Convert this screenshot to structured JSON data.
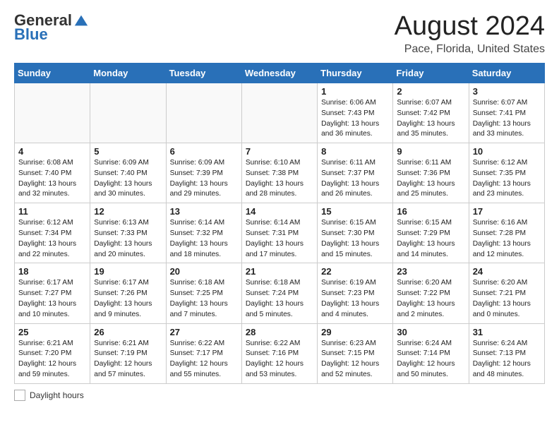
{
  "header": {
    "logo_general": "General",
    "logo_blue": "Blue",
    "month_title": "August 2024",
    "location": "Pace, Florida, United States"
  },
  "weekdays": [
    "Sunday",
    "Monday",
    "Tuesday",
    "Wednesday",
    "Thursday",
    "Friday",
    "Saturday"
  ],
  "weeks": [
    [
      {
        "day": "",
        "info": ""
      },
      {
        "day": "",
        "info": ""
      },
      {
        "day": "",
        "info": ""
      },
      {
        "day": "",
        "info": ""
      },
      {
        "day": "1",
        "info": "Sunrise: 6:06 AM\nSunset: 7:43 PM\nDaylight: 13 hours\nand 36 minutes."
      },
      {
        "day": "2",
        "info": "Sunrise: 6:07 AM\nSunset: 7:42 PM\nDaylight: 13 hours\nand 35 minutes."
      },
      {
        "day": "3",
        "info": "Sunrise: 6:07 AM\nSunset: 7:41 PM\nDaylight: 13 hours\nand 33 minutes."
      }
    ],
    [
      {
        "day": "4",
        "info": "Sunrise: 6:08 AM\nSunset: 7:40 PM\nDaylight: 13 hours\nand 32 minutes."
      },
      {
        "day": "5",
        "info": "Sunrise: 6:09 AM\nSunset: 7:40 PM\nDaylight: 13 hours\nand 30 minutes."
      },
      {
        "day": "6",
        "info": "Sunrise: 6:09 AM\nSunset: 7:39 PM\nDaylight: 13 hours\nand 29 minutes."
      },
      {
        "day": "7",
        "info": "Sunrise: 6:10 AM\nSunset: 7:38 PM\nDaylight: 13 hours\nand 28 minutes."
      },
      {
        "day": "8",
        "info": "Sunrise: 6:11 AM\nSunset: 7:37 PM\nDaylight: 13 hours\nand 26 minutes."
      },
      {
        "day": "9",
        "info": "Sunrise: 6:11 AM\nSunset: 7:36 PM\nDaylight: 13 hours\nand 25 minutes."
      },
      {
        "day": "10",
        "info": "Sunrise: 6:12 AM\nSunset: 7:35 PM\nDaylight: 13 hours\nand 23 minutes."
      }
    ],
    [
      {
        "day": "11",
        "info": "Sunrise: 6:12 AM\nSunset: 7:34 PM\nDaylight: 13 hours\nand 22 minutes."
      },
      {
        "day": "12",
        "info": "Sunrise: 6:13 AM\nSunset: 7:33 PM\nDaylight: 13 hours\nand 20 minutes."
      },
      {
        "day": "13",
        "info": "Sunrise: 6:14 AM\nSunset: 7:32 PM\nDaylight: 13 hours\nand 18 minutes."
      },
      {
        "day": "14",
        "info": "Sunrise: 6:14 AM\nSunset: 7:31 PM\nDaylight: 13 hours\nand 17 minutes."
      },
      {
        "day": "15",
        "info": "Sunrise: 6:15 AM\nSunset: 7:30 PM\nDaylight: 13 hours\nand 15 minutes."
      },
      {
        "day": "16",
        "info": "Sunrise: 6:15 AM\nSunset: 7:29 PM\nDaylight: 13 hours\nand 14 minutes."
      },
      {
        "day": "17",
        "info": "Sunrise: 6:16 AM\nSunset: 7:28 PM\nDaylight: 13 hours\nand 12 minutes."
      }
    ],
    [
      {
        "day": "18",
        "info": "Sunrise: 6:17 AM\nSunset: 7:27 PM\nDaylight: 13 hours\nand 10 minutes."
      },
      {
        "day": "19",
        "info": "Sunrise: 6:17 AM\nSunset: 7:26 PM\nDaylight: 13 hours\nand 9 minutes."
      },
      {
        "day": "20",
        "info": "Sunrise: 6:18 AM\nSunset: 7:25 PM\nDaylight: 13 hours\nand 7 minutes."
      },
      {
        "day": "21",
        "info": "Sunrise: 6:18 AM\nSunset: 7:24 PM\nDaylight: 13 hours\nand 5 minutes."
      },
      {
        "day": "22",
        "info": "Sunrise: 6:19 AM\nSunset: 7:23 PM\nDaylight: 13 hours\nand 4 minutes."
      },
      {
        "day": "23",
        "info": "Sunrise: 6:20 AM\nSunset: 7:22 PM\nDaylight: 13 hours\nand 2 minutes."
      },
      {
        "day": "24",
        "info": "Sunrise: 6:20 AM\nSunset: 7:21 PM\nDaylight: 13 hours\nand 0 minutes."
      }
    ],
    [
      {
        "day": "25",
        "info": "Sunrise: 6:21 AM\nSunset: 7:20 PM\nDaylight: 12 hours\nand 59 minutes."
      },
      {
        "day": "26",
        "info": "Sunrise: 6:21 AM\nSunset: 7:19 PM\nDaylight: 12 hours\nand 57 minutes."
      },
      {
        "day": "27",
        "info": "Sunrise: 6:22 AM\nSunset: 7:17 PM\nDaylight: 12 hours\nand 55 minutes."
      },
      {
        "day": "28",
        "info": "Sunrise: 6:22 AM\nSunset: 7:16 PM\nDaylight: 12 hours\nand 53 minutes."
      },
      {
        "day": "29",
        "info": "Sunrise: 6:23 AM\nSunset: 7:15 PM\nDaylight: 12 hours\nand 52 minutes."
      },
      {
        "day": "30",
        "info": "Sunrise: 6:24 AM\nSunset: 7:14 PM\nDaylight: 12 hours\nand 50 minutes."
      },
      {
        "day": "31",
        "info": "Sunrise: 6:24 AM\nSunset: 7:13 PM\nDaylight: 12 hours\nand 48 minutes."
      }
    ]
  ],
  "footer": {
    "daylight_label": "Daylight hours"
  }
}
